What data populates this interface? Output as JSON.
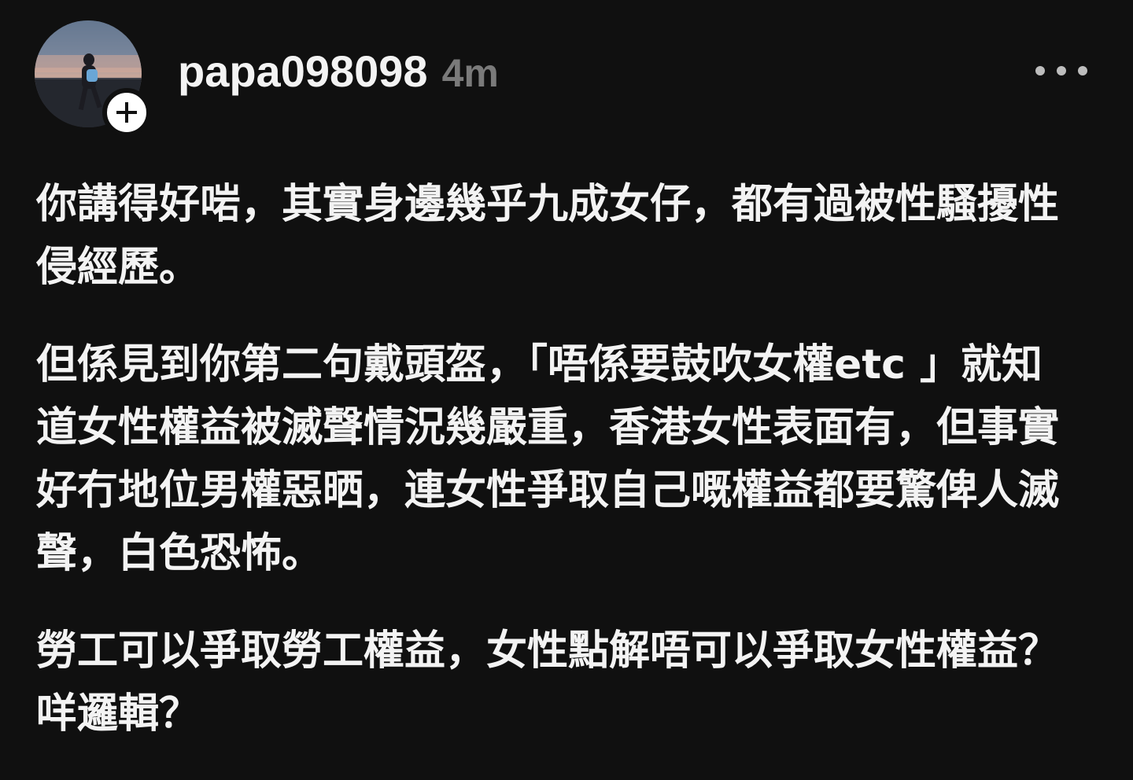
{
  "post": {
    "username": "papa098098",
    "timestamp": "4m",
    "paragraphs": [
      "你講得好啱，其實身邊幾乎九成女仔，都有過被性騷擾性侵經歷。",
      "但係見到你第二句戴頭盔，「唔係要鼓吹女權etc ￼」就知道女性權益被滅聲￼￼情況幾嚴重，香港女性表面有，但事實好冇地位男權惡晒，連女性爭取自己嘅權益都要驚俾人滅聲￼，白色恐怖。",
      "勞工可以爭取勞工權益，女性點解唔可以爭取女性權益？￼咩邏輯？"
    ]
  },
  "icons": {
    "follow": "plus-icon",
    "more": "more-horizontal-icon",
    "avatar": "profile-photo"
  },
  "colors": {
    "background": "#101010",
    "text": "#f3f3f3",
    "muted": "#7a7a7a"
  }
}
